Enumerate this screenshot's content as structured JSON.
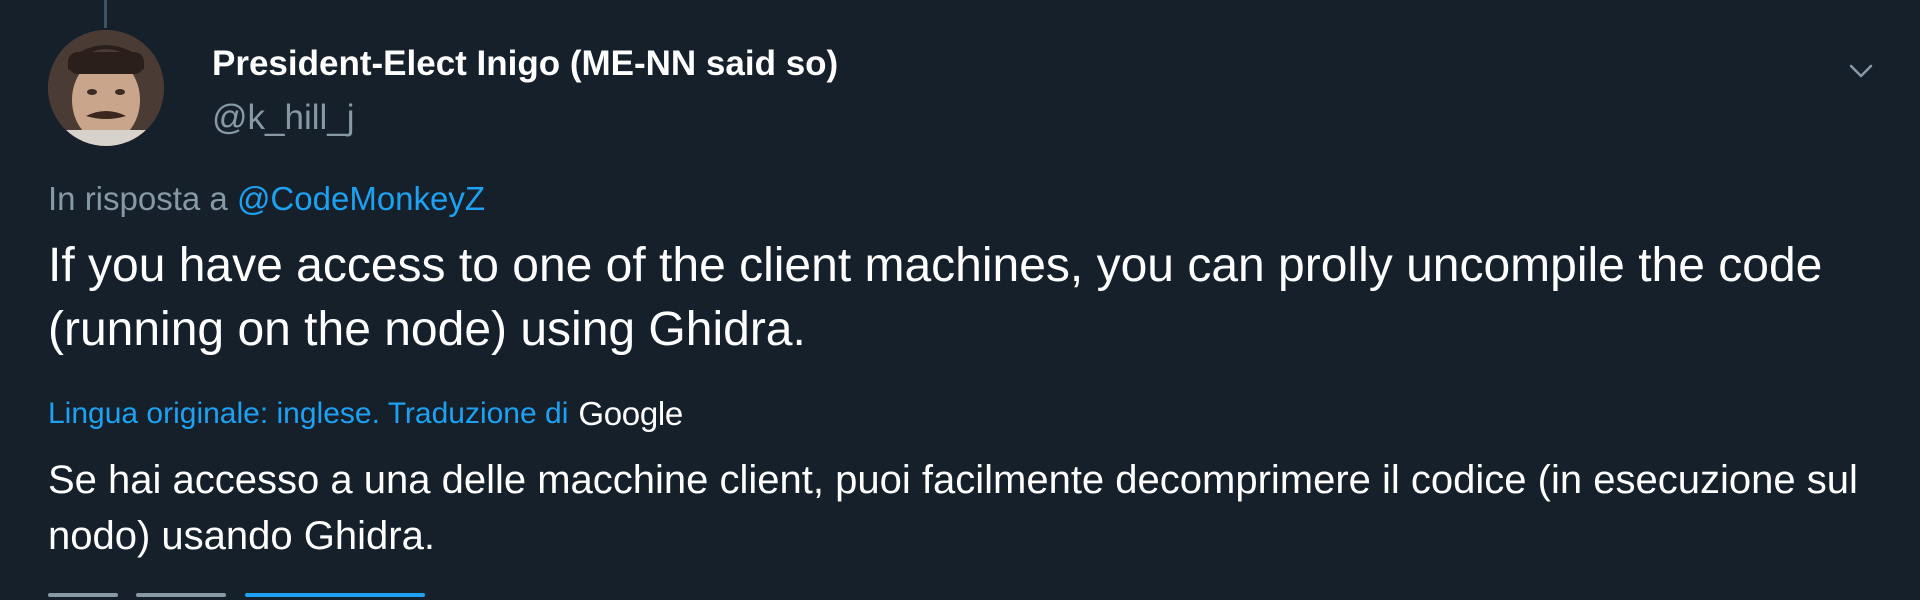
{
  "tweet": {
    "author": {
      "display_name": "President-Elect Inigo (ME-NN said so)",
      "handle": "@k_hill_j"
    },
    "reply_context": {
      "prefix": "In risposta a",
      "mention": "@CodeMonkeyZ"
    },
    "text": "If you have access to one of the client machines, you can prolly uncompile the code (running on the node) using Ghidra.",
    "translation": {
      "credit": "Lingua originale: inglese. Traduzione di",
      "provider": "Google",
      "text": "Se hai accesso a una delle macchine client, puoi facilmente decomprimere il codice (in esecuzione sul nodo) usando Ghidra."
    }
  },
  "icons": {
    "more_menu": "chevron-down-icon"
  },
  "colors": {
    "background": "#15202b",
    "primary_text": "#ffffff",
    "secondary_text": "#8899a6",
    "link": "#1da1f2"
  }
}
